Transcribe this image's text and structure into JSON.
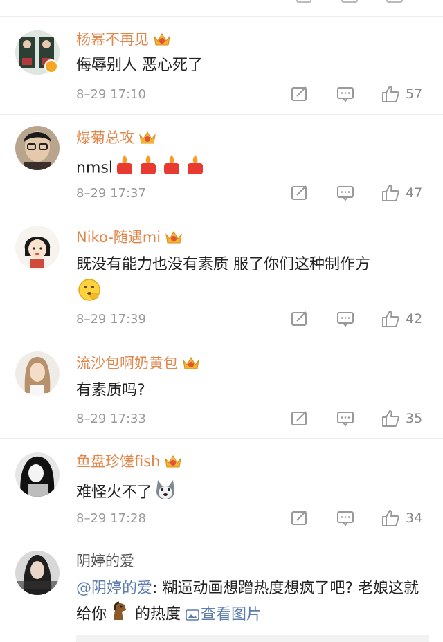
{
  "comments": [
    {
      "name": "杨幂不再见",
      "text": "侮辱别人 恶心死了",
      "time": "8–29 17:10",
      "likes": "57",
      "vip": true,
      "verified": true
    },
    {
      "name": "爆菊总攻",
      "text": "nmsl",
      "time": "8–29 17:37",
      "likes": "47",
      "vip": true,
      "emojis": [
        "candle-emoji",
        "candle-emoji",
        "candle-emoji",
        "candle-emoji"
      ]
    },
    {
      "name": "Niko-随遇mi",
      "text": "既没有能力也没有素质 服了你们这种制作方",
      "time": "8–29 17:39",
      "likes": "42",
      "vip": true,
      "emojis": [
        "thinking-emoji"
      ]
    },
    {
      "name": "流沙包啊奶黄包",
      "text": "有素质吗?",
      "time": "8–29 17:33",
      "likes": "35",
      "vip": true
    },
    {
      "name": "鱼盘珍馐fish",
      "text": "难怪火不了",
      "time": "8–29 17:28",
      "likes": "34",
      "vip": true,
      "emojis": [
        "husky-emoji"
      ]
    },
    {
      "name": "阴婷的爱",
      "mention": "@阴婷的爱",
      "text_before": ": 糊逼动画想蹭热度想疯了吧? 老娘这就给你",
      "text_after": " 的热度 ",
      "view_image": "查看图片",
      "emojis": [
        "horse-emoji"
      ],
      "vip": false
    }
  ],
  "colors": {
    "name": "#e2874b",
    "time": "#9a9a9a",
    "link": "#5d7dae",
    "text": "#222222"
  }
}
